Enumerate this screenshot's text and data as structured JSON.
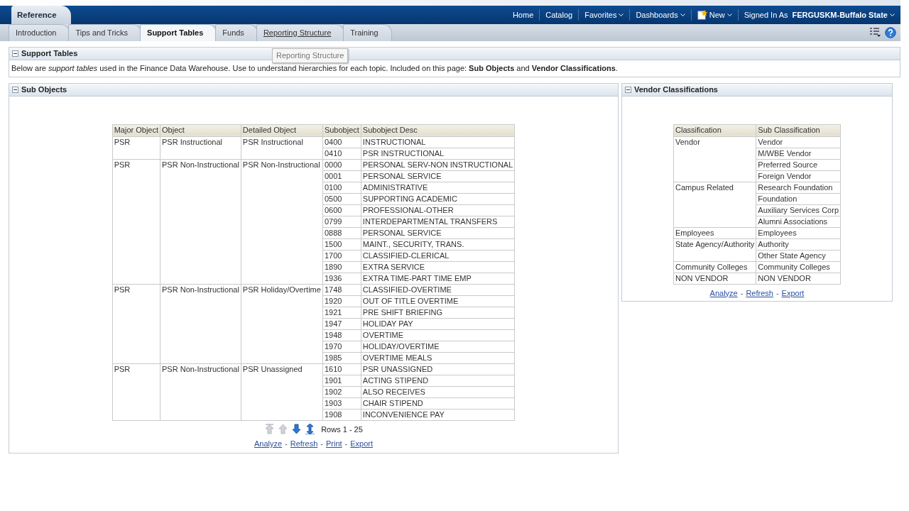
{
  "header": {
    "title": "Reference",
    "nav": [
      {
        "label": "Home",
        "caret": false,
        "icon": false
      },
      {
        "label": "Catalog",
        "caret": false,
        "icon": false
      },
      {
        "label": "Favorites",
        "caret": true,
        "icon": false
      },
      {
        "label": "Dashboards",
        "caret": true,
        "icon": false
      },
      {
        "label": "New",
        "caret": true,
        "icon": true
      }
    ],
    "signed_in_label": "Signed In As",
    "user": "FERGUSKM-Buffalo State"
  },
  "tabs": [
    {
      "label": "Introduction",
      "selected": false,
      "hovered": false
    },
    {
      "label": "Tips and Tricks",
      "selected": false,
      "hovered": false
    },
    {
      "label": "Support Tables",
      "selected": true,
      "hovered": false
    },
    {
      "label": "Funds",
      "selected": false,
      "hovered": false
    },
    {
      "label": "Reporting Structure",
      "selected": false,
      "hovered": true
    },
    {
      "label": "Training",
      "selected": false,
      "hovered": false
    }
  ],
  "tooltip": "Reporting Structure",
  "intro_panel": {
    "title": "Support Tables",
    "text": "Below are *support tables* used in the Finance Data Warehouse. Use to understand hierarchies for each topic. Included on this page: **Sub Objects** and **Vendor Classifications**."
  },
  "sub_objects": {
    "title": "Sub Objects",
    "columns": [
      "Major Object",
      "Object",
      "Detailed Object",
      "Subobject",
      "Subobject Desc"
    ],
    "groups": [
      {
        "major": "PSR",
        "object": "PSR Instructional",
        "detailed": "PSR Instructional",
        "rows": [
          [
            "0400",
            "INSTRUCTIONAL"
          ],
          [
            "0410",
            "PSR INSTRUCTIONAL"
          ]
        ]
      },
      {
        "major": "PSR",
        "object": "PSR Non-Instructional",
        "detailed": "PSR Non-Instructional",
        "rows": [
          [
            "0000",
            "PERSONAL SERV-NON INSTRUCTIONAL"
          ],
          [
            "0001",
            "PERSONAL SERVICE"
          ],
          [
            "0100",
            "ADMINISTRATIVE"
          ],
          [
            "0500",
            "SUPPORTING ACADEMIC"
          ],
          [
            "0600",
            "PROFESSIONAL-OTHER"
          ],
          [
            "0799",
            "INTERDEPARTMENTAL TRANSFERS"
          ],
          [
            "0888",
            "PERSONAL SERVICE"
          ],
          [
            "1500",
            "MAINT., SECURITY, TRANS."
          ],
          [
            "1700",
            "CLASSIFIED-CLERICAL"
          ],
          [
            "1890",
            "EXTRA SERVICE"
          ],
          [
            "1936",
            "EXTRA TIME-PART TIME EMP"
          ]
        ]
      },
      {
        "major": "PSR",
        "object": "PSR Non-Instructional",
        "detailed": "PSR Holiday/Overtime",
        "rows": [
          [
            "1748",
            "CLASSIFIED-OVERTIME"
          ],
          [
            "1920",
            "OUT OF TITLE OVERTIME"
          ],
          [
            "1921",
            "PRE SHIFT BRIEFING"
          ],
          [
            "1947",
            "HOLIDAY PAY"
          ],
          [
            "1948",
            "OVERTIME"
          ],
          [
            "1970",
            "HOLIDAY/OVERTIME"
          ],
          [
            "1985",
            "OVERTIME MEALS"
          ]
        ]
      },
      {
        "major": "PSR",
        "object": "PSR Non-Instructional",
        "detailed": "PSR Unassigned",
        "rows": [
          [
            "1610",
            "PSR UNASSIGNED"
          ],
          [
            "1901",
            "ACTING STIPEND"
          ],
          [
            "1902",
            "ALSO RECEIVES"
          ],
          [
            "1903",
            "CHAIR STIPEND"
          ],
          [
            "1908",
            "INCONVENIENCE PAY"
          ]
        ]
      }
    ],
    "pager": [
      {
        "kind": "first",
        "disabled": true
      },
      {
        "kind": "prev",
        "disabled": true
      },
      {
        "kind": "next",
        "disabled": false
      },
      {
        "kind": "all",
        "disabled": false
      }
    ],
    "rows_label": "Rows 1 - 25",
    "links": [
      "Analyze",
      "Refresh",
      "Print",
      "Export"
    ],
    "link_separator": "-"
  },
  "vendor": {
    "title": "Vendor Classifications",
    "columns": [
      "Classification",
      "Sub Classification"
    ],
    "groups": [
      {
        "classification": "Vendor",
        "subs": [
          "Vendor",
          "M/WBE Vendor",
          "Preferred Source",
          "Foreign Vendor"
        ]
      },
      {
        "classification": "Campus Related",
        "subs": [
          "Research Foundation",
          "Foundation",
          "Auxiliary Services Corp",
          "Alumni Associations"
        ]
      },
      {
        "classification": "Employees",
        "subs": [
          "Employees"
        ]
      },
      {
        "classification": "State Agency/Authority",
        "subs": [
          "Authority",
          "Other State Agency"
        ]
      },
      {
        "classification": "Community Colleges",
        "subs": [
          "Community Colleges"
        ]
      },
      {
        "classification": "NON VENDOR",
        "subs": [
          "NON VENDOR"
        ]
      }
    ],
    "links": [
      "Analyze",
      "Refresh",
      "Export"
    ],
    "link_separator": "-"
  }
}
